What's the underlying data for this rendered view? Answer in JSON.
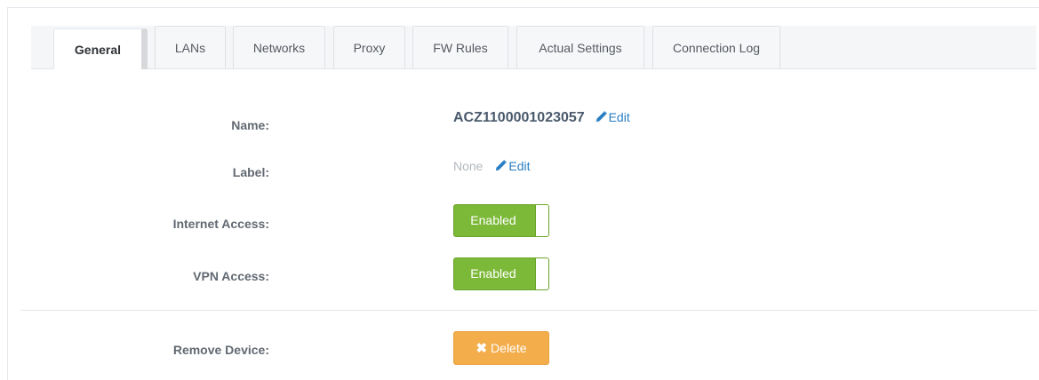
{
  "tabs": [
    {
      "label": "General",
      "active": true
    },
    {
      "label": "LANs",
      "active": false
    },
    {
      "label": "Networks",
      "active": false
    },
    {
      "label": "Proxy",
      "active": false
    },
    {
      "label": "FW Rules",
      "active": false
    },
    {
      "label": "Actual Settings",
      "active": false
    },
    {
      "label": "Connection Log",
      "active": false
    }
  ],
  "general": {
    "name_label": "Name:",
    "name_value": "ACZ1100001023057",
    "label_label": "Label:",
    "label_value": "None",
    "edit_label": "Edit",
    "internet_label": "Internet Access:",
    "internet_state": "Enabled",
    "vpn_label": "VPN Access:",
    "vpn_state": "Enabled",
    "remove_label": "Remove Device:",
    "delete_label": "Delete"
  },
  "colors": {
    "toggle_on": "#7cb938",
    "delete": "#f3ad4b",
    "link": "#2a7ec3"
  },
  "icons": {
    "edit": "pencil-icon",
    "delete": "times-icon"
  }
}
